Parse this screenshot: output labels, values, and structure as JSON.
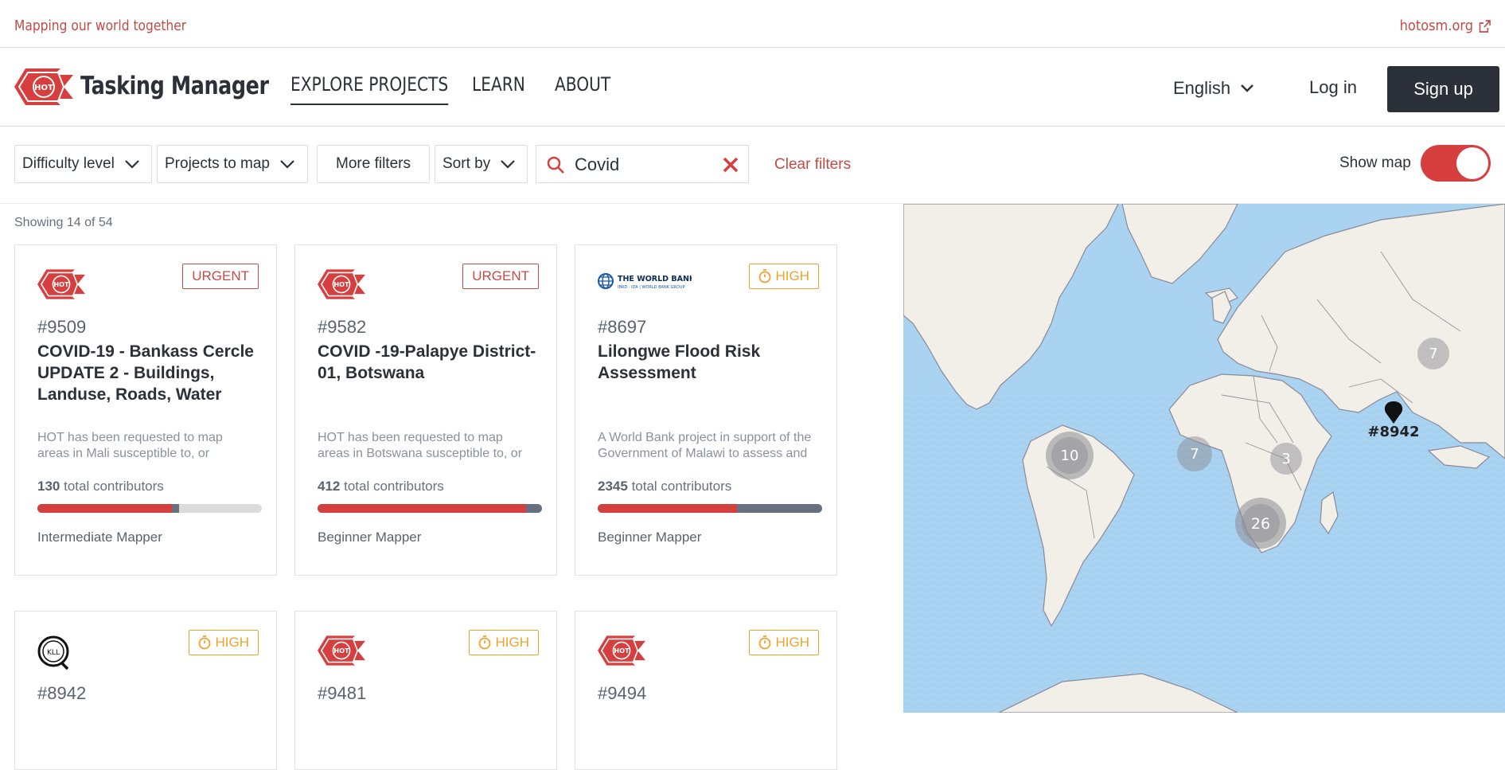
{
  "topbar": {
    "tagline": "Mapping our world together",
    "site_link": "hotosm.org"
  },
  "nav": {
    "brand": "Tasking Manager",
    "links": [
      "EXPLORE PROJECTS",
      "LEARN",
      "ABOUT"
    ],
    "language": "English",
    "login": "Log in",
    "signup": "Sign up"
  },
  "filters": {
    "difficulty": "Difficulty level",
    "projects_to_map": "Projects to map",
    "more_filters": "More filters",
    "sort_by": "Sort by",
    "search_value": "Covid",
    "clear": "Clear filters",
    "show_map": "Show map",
    "show_map_on": true
  },
  "results": {
    "showing": "Showing 14 of 54"
  },
  "projects": [
    {
      "org": "hot-logo",
      "priority": "URGENT",
      "id": "#9509",
      "title": "COVID-19 - Bankass Cercle UPDATE 2 - Buildings, Landuse, Roads, Water",
      "desc": "HOT has been requested to map areas in Mali susceptible to, or identified as having outbreaks",
      "contributors": "130",
      "contributors_label": "total contributors",
      "mapped": 0.6,
      "validated": 0.63,
      "level": "Intermediate Mapper"
    },
    {
      "org": "hot-logo",
      "priority": "URGENT",
      "id": "#9582",
      "title": "COVID -19-Palapye District-01, Botswana",
      "desc": "HOT has been requested to map areas in Botswana susceptible to, or identified as having outbreaks",
      "contributors": "412",
      "contributors_label": "total contributors",
      "mapped": 0.93,
      "validated": 1.0,
      "level": "Beginner Mapper"
    },
    {
      "org": "world-bank-logo",
      "priority": "HIGH",
      "id": "#8697",
      "title": "Lilongwe Flood Risk Assessment",
      "desc": "A World Bank project in support of the Government of Malawi to assess and manage flood risk in",
      "contributors": "2345",
      "contributors_label": "total contributors",
      "mapped": 0.62,
      "validated": 1.0,
      "level": "Beginner Mapper"
    },
    {
      "org": "kll-logo",
      "priority": "HIGH",
      "id": "#8942"
    },
    {
      "org": "hot-logo",
      "priority": "HIGH",
      "id": "#9481"
    },
    {
      "org": "hot-logo",
      "priority": "HIGH",
      "id": "#9494"
    }
  ],
  "map": {
    "clusters": [
      "10",
      "7",
      "3",
      "26",
      "7"
    ],
    "marker_label": "#8942"
  },
  "colors": {
    "accent": "#d73f3f",
    "dark": "#2c3038",
    "high": "#f0a12e",
    "water": "#aad3f2",
    "land": "#f2efe9"
  }
}
